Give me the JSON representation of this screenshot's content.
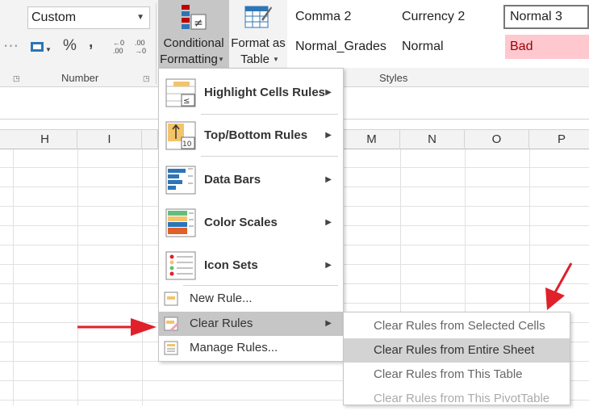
{
  "ribbon": {
    "number_format_value": "Custom",
    "percent_label": "%",
    "comma_label": ",",
    "decimal_increase_label": "←0 .00",
    "decimal_decrease_label": ".00 →0",
    "number_group_label": "Number",
    "styles_group_label": "Styles",
    "conditional_formatting_line1": "Conditional",
    "conditional_formatting_line2": "Formatting",
    "format_as_table_line1": "Format as",
    "format_as_table_line2": "Table",
    "styles": [
      {
        "name": "Comma 2"
      },
      {
        "name": "Currency 2"
      },
      {
        "name": "Normal 3"
      },
      {
        "name": "Normal_Grades"
      },
      {
        "name": "Normal"
      },
      {
        "name": "Bad"
      }
    ]
  },
  "columns": [
    "H",
    "I",
    "M",
    "N",
    "O",
    "P"
  ],
  "cf_menu": {
    "items_big": [
      {
        "label": "Highlight Cells Rules",
        "icon": "highlight-cells-icon"
      },
      {
        "label": "Top/Bottom Rules",
        "icon": "top-bottom-icon"
      },
      {
        "label": "Data Bars",
        "icon": "data-bars-icon"
      },
      {
        "label": "Color Scales",
        "icon": "color-scales-icon"
      },
      {
        "label": "Icon Sets",
        "icon": "icon-sets-icon"
      }
    ],
    "items_small": [
      {
        "label": "New Rule...",
        "icon": "new-rule-icon"
      },
      {
        "label": "Clear Rules",
        "icon": "clear-rules-icon"
      },
      {
        "label": "Manage Rules...",
        "icon": "manage-rules-icon"
      }
    ]
  },
  "clear_submenu": [
    {
      "label": "Clear Rules from Selected Cells"
    },
    {
      "label": "Clear Rules from Entire Sheet"
    },
    {
      "label": "Clear Rules from This Table"
    },
    {
      "label": "Clear Rules from This PivotTable"
    }
  ],
  "colors": {
    "accent_arrow": "#e0202a",
    "bad_bg": "#ffc7ce",
    "bad_fg": "#9c0006",
    "highlight": "#c6c6c6"
  }
}
